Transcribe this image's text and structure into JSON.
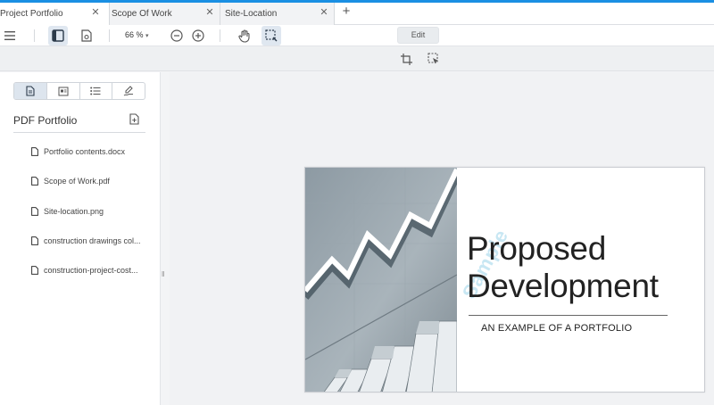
{
  "tabs": [
    {
      "label": "Project Portfolio",
      "active": true
    },
    {
      "label": "Scope Of Work",
      "active": false
    },
    {
      "label": "Site-Location",
      "active": false
    }
  ],
  "tab_close_glyph": "✕",
  "new_tab_glyph": "+",
  "toolbar": {
    "zoom_label": "66 %",
    "edit_label": "Edit"
  },
  "sidebar": {
    "title": "PDF Portfolio",
    "files": [
      {
        "name": "Portfolio contents.docx"
      },
      {
        "name": "Scope of Work.pdf"
      },
      {
        "name": "Site-location.png"
      },
      {
        "name": "construction drawings col..."
      },
      {
        "name": "construction-project-cost..."
      }
    ]
  },
  "document": {
    "title_line1": "Proposed",
    "title_line2": "Development",
    "subtitle": "AN EXAMPLE OF A PORTFOLIO",
    "watermark": "Sample"
  },
  "colors": {
    "accent": "#1a8fe3",
    "selected_tool_bg": "#dfe7f0"
  }
}
